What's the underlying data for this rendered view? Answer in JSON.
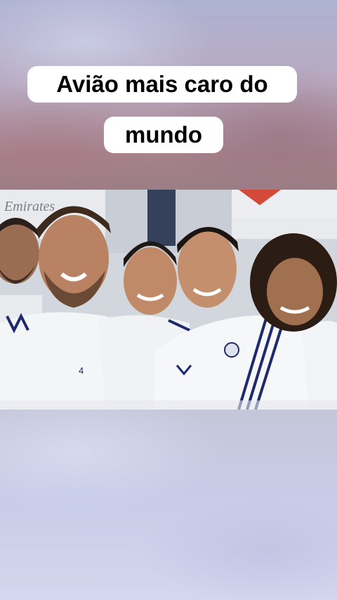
{
  "caption": {
    "line1": "Avião mais caro do",
    "line2": "mundo"
  },
  "photo": {
    "backdrop_text": "Emirates"
  },
  "colors": {
    "caption_bg": "#ffffff",
    "caption_text": "#000000",
    "kit_white": "#f4f5f7",
    "kit_stripe": "#1e2a6b"
  }
}
